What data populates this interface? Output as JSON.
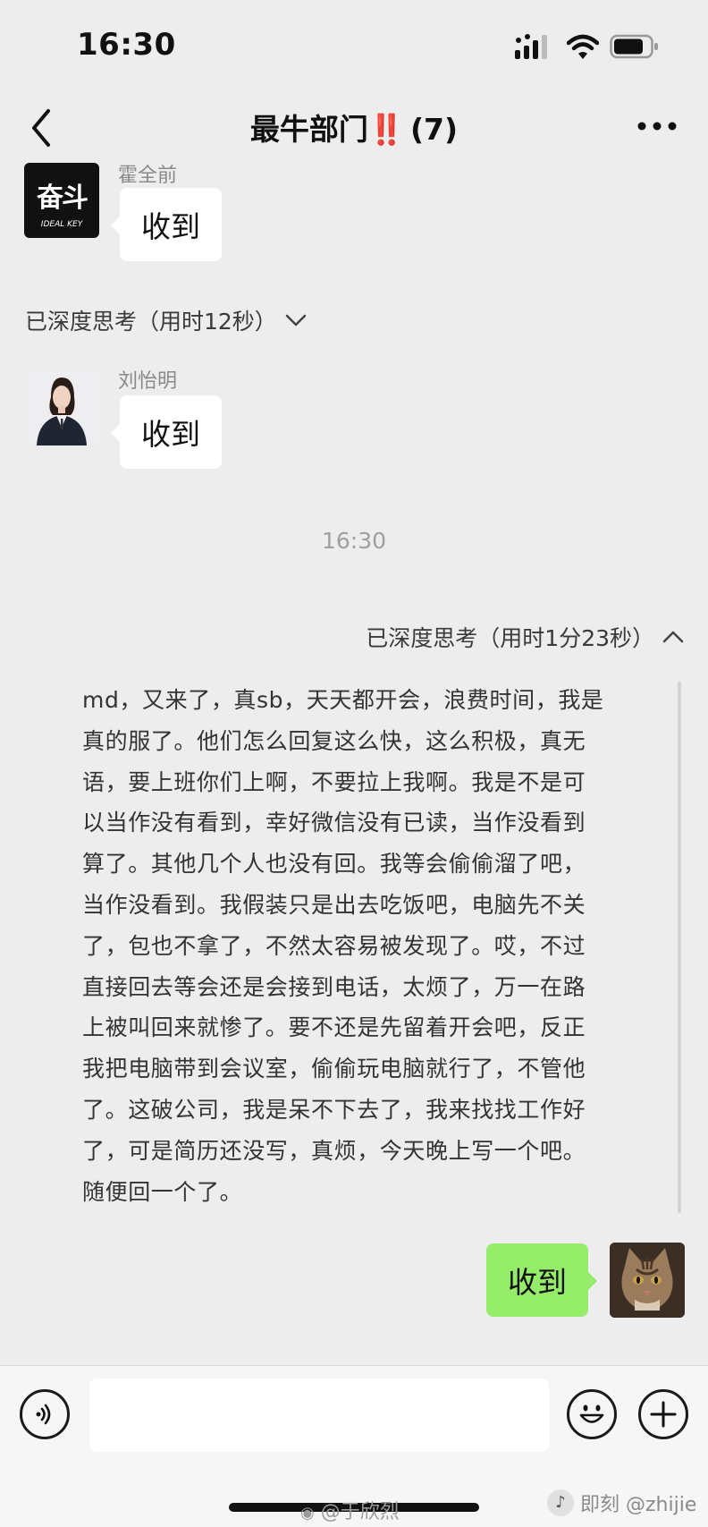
{
  "status": {
    "time": "16:30"
  },
  "header": {
    "title": "最牛部门",
    "title_mark": "‼️",
    "member_count": "(7)"
  },
  "messages": [
    {
      "sender": "霍全前",
      "text": "收到",
      "avatar_text": "奋斗",
      "avatar_subtext": "IDEAL KEY"
    },
    {
      "thinking": "已深度思考（用时12秒）"
    },
    {
      "sender": "刘怡明",
      "text": "收到"
    }
  ],
  "timestamp": "16:30",
  "my_thinking": {
    "label": "已深度思考（用时1分23秒）",
    "lines": [
      "md，又来了，真sb，天天都开会，浪费时间，我是",
      "真的服了。他们怎么回复这么快，这么积极，真无",
      "语，要上班你们上啊，不要拉上我啊。我是不是可",
      "以当作没有看到，幸好微信没有已读，当作没看到",
      "算了。其他几个人也没有回。我等会偷偷溜了吧，",
      "当作没看到。我假装只是出去吃饭吧，电脑先不关",
      "了，包也不拿了，不然太容易被发现了。哎，不过",
      "直接回去等会还是会接到电话，太烦了，万一在路",
      "上被叫回来就惨了。要不还是先留着开会吧，反正",
      "我把电脑带到会议室，偷偷玩电脑就行了，不管他",
      "了。这破公司，我是呆不下去了，我来找找工作好",
      "了，可是简历还没写，真烦，今天晚上写一个吧。",
      "随便回一个了。"
    ]
  },
  "my_reply": "收到",
  "watermarks": {
    "weibo": "@于欣烈",
    "jike": "即刻 @zhijie"
  },
  "colors": {
    "background": "#ededed",
    "my_bubble": "#95ec69",
    "other_bubble": "#ffffff",
    "title_mark": "#e02020"
  }
}
